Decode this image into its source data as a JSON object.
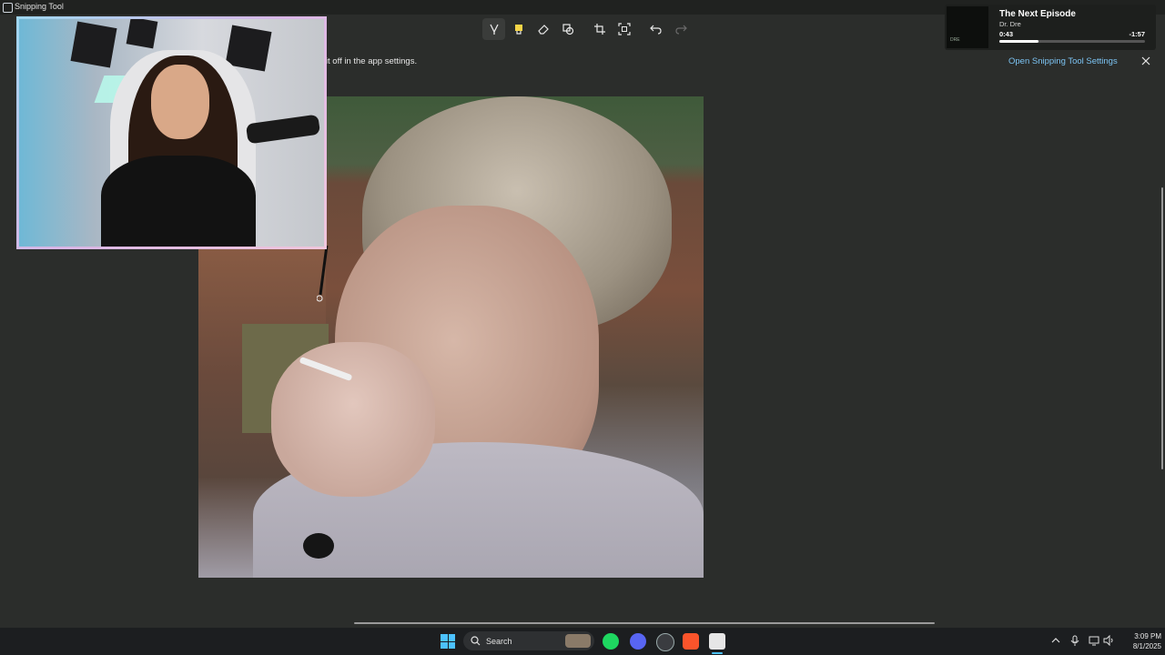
{
  "window": {
    "title": "Snipping Tool"
  },
  "toolbar": {
    "tools": [
      {
        "name": "ballpoint-pen",
        "active": true
      },
      {
        "name": "highlighter",
        "active": false
      },
      {
        "name": "eraser",
        "active": false
      },
      {
        "name": "shapes",
        "active": false
      },
      {
        "name": "crop",
        "active": false
      },
      {
        "name": "text-actions",
        "active": false
      },
      {
        "name": "undo",
        "active": false
      },
      {
        "name": "redo",
        "active": false
      }
    ]
  },
  "infobar": {
    "message": "n it off in the app settings.",
    "link_label": "Open Snipping Tool Settings",
    "close_icon": "close-icon"
  },
  "now_playing": {
    "title": "The Next Episode",
    "artist": "Dr. Dre",
    "elapsed": "0:43",
    "remaining": "-1:57",
    "progress": 0.27
  },
  "taskbar": {
    "search_placeholder": "Search",
    "apps": [
      "start-icon",
      "search-icon",
      "spotify-icon",
      "discord-icon",
      "steam-icon",
      "brave-icon",
      "snipping-tool-icon"
    ],
    "tray": [
      "chevron-up-icon",
      "microphone-icon",
      "display-icon",
      "speaker-icon"
    ],
    "clock": {
      "time": "3:09 PM",
      "date": "8/1/2025"
    }
  },
  "colors": {
    "accent": "#4cc2ff",
    "link": "#7cc4f4",
    "background": "#2b2d2b",
    "taskbar": "#1c1e20"
  }
}
